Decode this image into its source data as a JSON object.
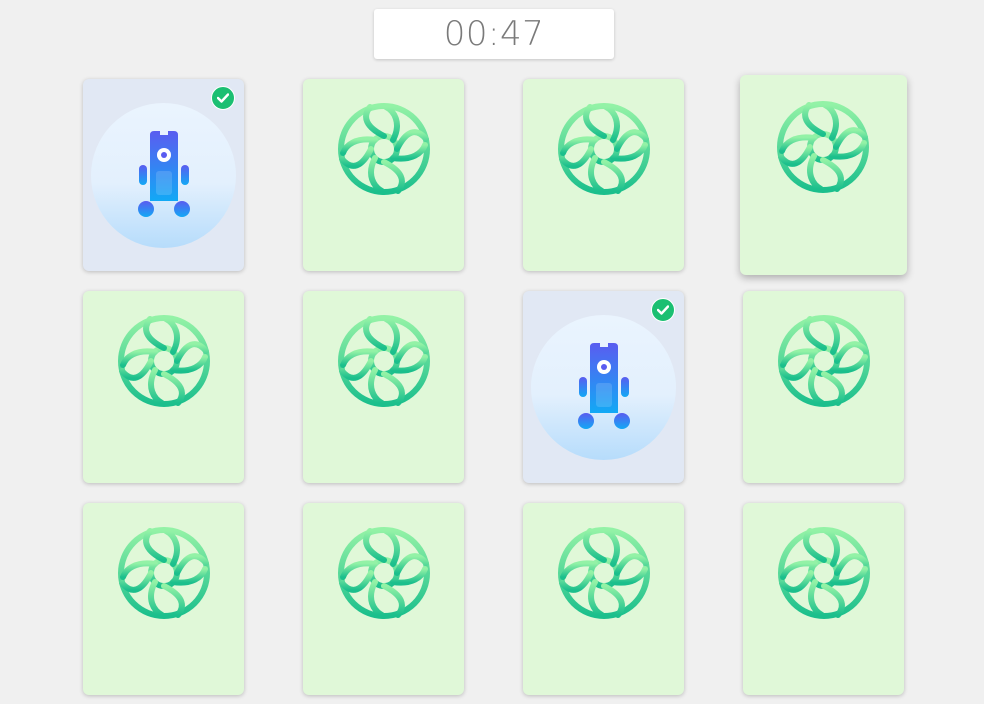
{
  "timer": {
    "value": "00:47"
  },
  "board": {
    "rows": 3,
    "cols": 4,
    "cards": [
      {
        "state": "matched",
        "symbol": "robot-toy-icon",
        "row": 1,
        "col": 1
      },
      {
        "state": "hidden",
        "symbol": "lollipop-icon",
        "row": 1,
        "col": 2
      },
      {
        "state": "hidden",
        "symbol": "lollipop-icon",
        "row": 1,
        "col": 3
      },
      {
        "state": "hidden-hover",
        "symbol": "lollipop-icon",
        "row": 1,
        "col": 4
      },
      {
        "state": "hidden",
        "symbol": "lollipop-icon",
        "row": 2,
        "col": 1
      },
      {
        "state": "hidden",
        "symbol": "lollipop-icon",
        "row": 2,
        "col": 2
      },
      {
        "state": "matched",
        "symbol": "robot-toy-icon",
        "row": 2,
        "col": 3
      },
      {
        "state": "hidden",
        "symbol": "lollipop-icon",
        "row": 2,
        "col": 4
      },
      {
        "state": "hidden",
        "symbol": "lollipop-icon",
        "row": 3,
        "col": 1
      },
      {
        "state": "hidden",
        "symbol": "lollipop-icon",
        "row": 3,
        "col": 2
      },
      {
        "state": "hidden",
        "symbol": "lollipop-icon",
        "row": 3,
        "col": 3
      },
      {
        "state": "hidden",
        "symbol": "lollipop-icon",
        "row": 3,
        "col": 4
      }
    ]
  },
  "colors": {
    "background": "#f0f0f0",
    "card_back": "#e0f8d8",
    "card_face": "#e1e8f4",
    "lollipop_top": "#93f2a6",
    "lollipop_bottom": "#1bbf8c",
    "robot_top": "#5a5cf0",
    "robot_bottom": "#12a9f5",
    "match_check": "#1bbf72"
  }
}
